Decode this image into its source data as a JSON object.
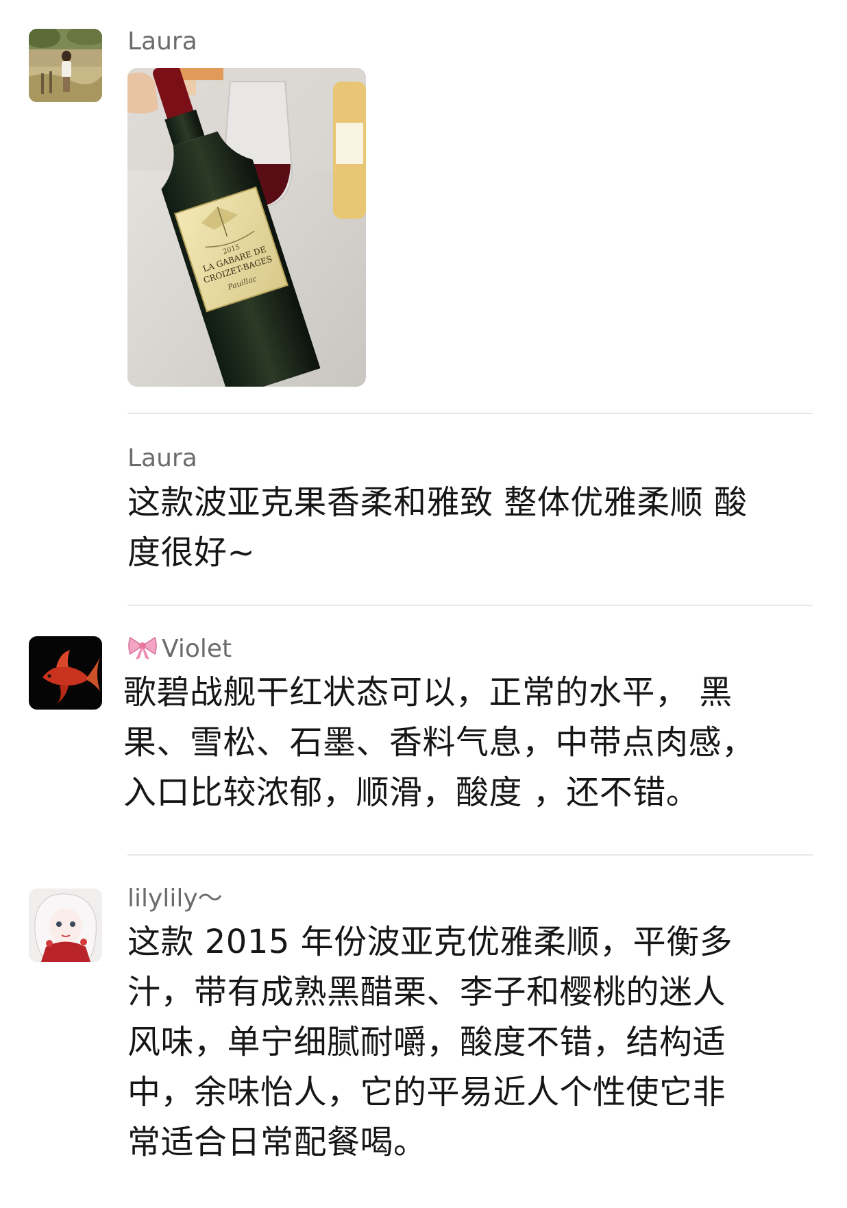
{
  "messages": [
    {
      "sender": "Laura",
      "image": {
        "label_vintage": "2015",
        "label_line1": "LA GABARE DE",
        "label_line2": "CROIZET-BAGES",
        "label_line3": "Pauillac"
      }
    },
    {
      "sender": "Laura",
      "text_line1": "这款波亚克果香柔和雅致 整体优雅柔顺 酸",
      "text_line2": "度很好~"
    },
    {
      "sender": "Violet",
      "sender_icon": "ribbon-bow-icon",
      "text_line1": "歌碧战舰干红状态可以，正常的水平，  黑",
      "text_line2": "果、雪松、石墨、香料气息，中带点肉感，",
      "text_line3": "入口比较浓郁，顺滑，酸度 ，还不错。"
    },
    {
      "sender": "lilylily～",
      "text_line1": "这款 2015 年份波亚克优雅柔顺，平衡多",
      "text_line2": "汁，带有成熟黑醋栗、李子和樱桃的迷人",
      "text_line3": "风味，单宁细腻耐嚼，酸度不错，结构适",
      "text_line4": "中，余味怡人，它的平易近人个性使它非",
      "text_line5": "常适合日常配餐喝。"
    }
  ],
  "colors": {
    "background": "#ffffff",
    "name": "#6b6b6b",
    "text": "#161616",
    "divider": "#e6e6e6"
  }
}
